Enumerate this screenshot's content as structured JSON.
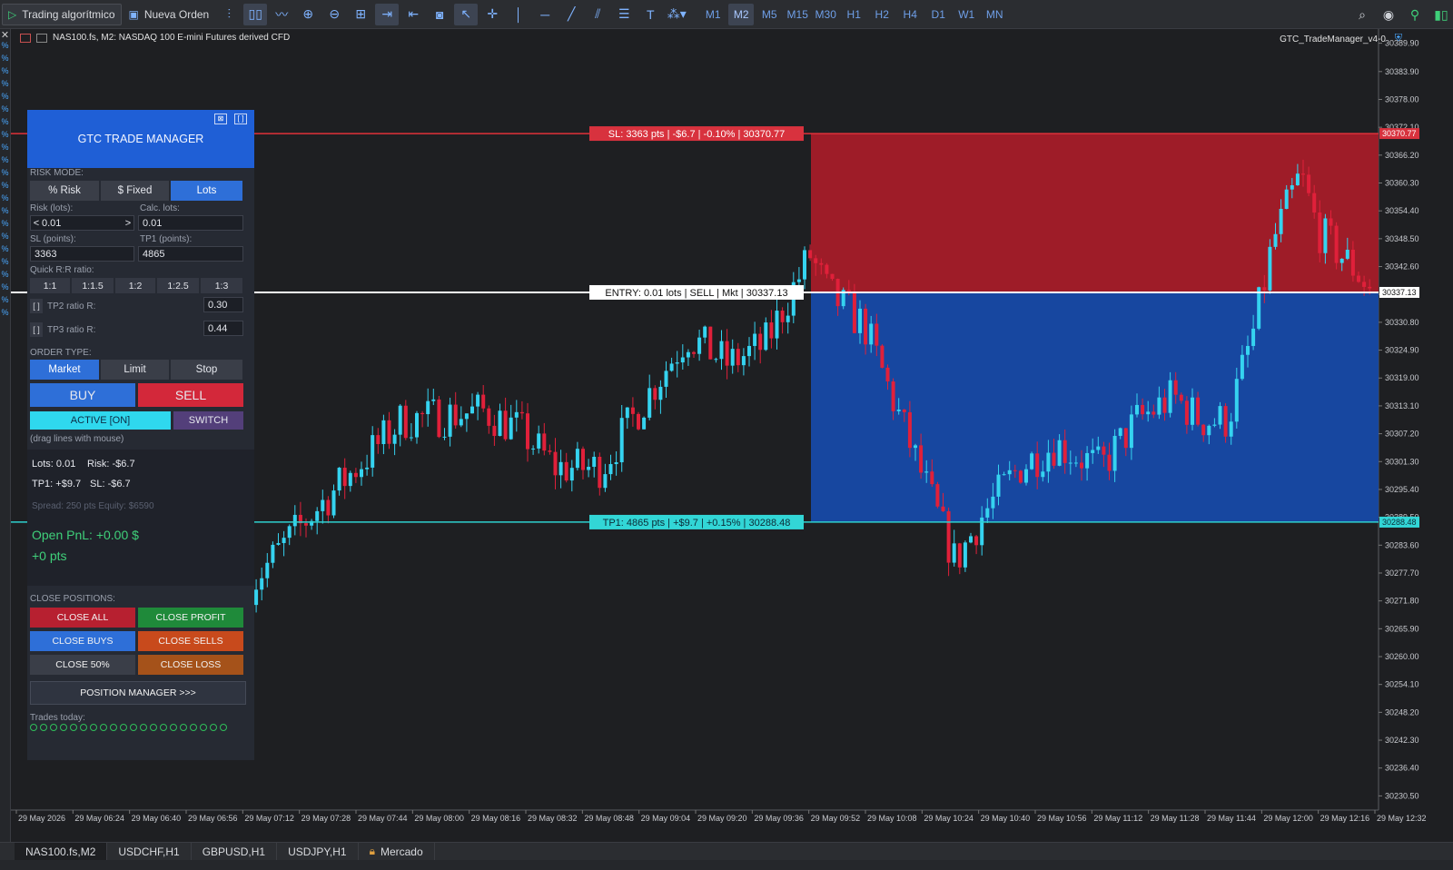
{
  "toolbar": {
    "algo_trading": "Trading algorítmico",
    "new_order": "Nueva Orden",
    "timeframes": [
      "M1",
      "M2",
      "M5",
      "M15",
      "M30",
      "H1",
      "H2",
      "H4",
      "D1",
      "W1",
      "MN"
    ],
    "active_timeframe": "M2"
  },
  "chart": {
    "symbol_title": "NAS100.fs, M2:  NASDAQ 100 E-mini Futures derived CFD",
    "ea_name": "GTC_TradeManager_v4-0",
    "price_levels": [
      "30389.90",
      "30383.90",
      "30378.00",
      "30372.10",
      "30366.20",
      "30360.30",
      "30354.40",
      "30348.50",
      "30342.60",
      "30336.70",
      "30330.80",
      "30324.90",
      "30319.00",
      "30313.10",
      "30307.20",
      "30301.30",
      "30295.40",
      "30289.50",
      "30283.60",
      "30277.70",
      "30271.80",
      "30265.90",
      "30260.00",
      "30254.10",
      "30248.20",
      "30242.30",
      "30236.40",
      "30230.50"
    ],
    "time_labels": [
      "29 May 2026",
      "29 May 06:24",
      "29 May 06:40",
      "29 May 06:56",
      "29 May 07:12",
      "29 May 07:28",
      "29 May 07:44",
      "29 May 08:00",
      "29 May 08:16",
      "29 May 08:32",
      "29 May 08:48",
      "29 May 09:04",
      "29 May 09:20",
      "29 May 09:36",
      "29 May 09:52",
      "29 May 10:08",
      "29 May 10:24",
      "29 May 10:40",
      "29 May 10:56",
      "29 May 11:12",
      "29 May 11:28",
      "29 May 11:44",
      "29 May 12:00",
      "29 May 12:16",
      "29 May 12:32"
    ],
    "sl_label": "SL: 3363 pts | -$6.7 | -0.10% | 30370.77",
    "entry_label": "ENTRY: 0.01 lots | SELL | Mkt | 30337.13",
    "tp_label": "TP1: 4865 pts | +$9.7 | +0.15% | 30288.48",
    "sl_price_tag": "30370.77",
    "entry_price_tag": "30337.13",
    "tp_price_tag": "30288.48",
    "colors": {
      "bull": "#35d3f0",
      "bear": "#e0203a",
      "sl_zone": "#9e1c28",
      "tp_zone": "#1747a0",
      "sl_line": "#e0303a",
      "tp_line": "#2fd0d0"
    }
  },
  "chart_data": {
    "type": "candlestick",
    "ylim": [
      30227.5,
      30392.9
    ],
    "sl": 30370.77,
    "entry": 30337.13,
    "tp": 30288.48
  },
  "panel": {
    "title": "GTC TRADE MANAGER",
    "risk_mode_label": "RISK MODE:",
    "risk_modes": [
      "% Risk",
      "$ Fixed",
      "Lots"
    ],
    "risk_label": "Risk (lots):",
    "risk_value": "0.01",
    "calc_lots_label": "Calc. lots:",
    "calc_lots_value": "0.01",
    "sl_points_label": "SL (points):",
    "sl_points_value": "3363",
    "tp1_points_label": "TP1 (points):",
    "tp1_points_value": "4865",
    "rr_label": "Quick R:R ratio:",
    "rr_ratios": [
      "1:1",
      "1:1.5",
      "1:2",
      "1:2.5",
      "1:3"
    ],
    "tp2_label": "TP2 ratio R:",
    "tp2_value": "0.30",
    "tp3_label": "TP3 ratio R:",
    "tp3_value": "0.44",
    "order_type_label": "ORDER TYPE:",
    "order_types": [
      "Market",
      "Limit",
      "Stop"
    ],
    "buy": "BUY",
    "sell": "SELL",
    "active": "ACTIVE [ON]",
    "switch": "SWITCH",
    "drag_hint": "(drag lines with mouse)",
    "lots_info": "Lots: 0.01",
    "risk_info": "Risk: -$6.7",
    "tp_info": "TP1: +$9.7",
    "sl_info": "SL: -$6.7",
    "spread_info": "Spread: 250 pts   Equity: $6590",
    "open_pnl": "Open PnL: +0.00 $",
    "open_pts": "+0 pts",
    "close_label": "CLOSE POSITIONS:",
    "close_all": "CLOSE ALL",
    "close_profit": "CLOSE PROFIT",
    "close_buys": "CLOSE BUYS",
    "close_sells": "CLOSE SELLS",
    "close_50": "CLOSE 50%",
    "close_loss": "CLOSE LOSS",
    "position_manager": "POSITION MANAGER  >>>",
    "trades_today": "Trades today:"
  },
  "bottom_tabs": [
    "NAS100.fs,M2",
    "USDCHF,H1",
    "GBPUSD,H1",
    "USDJPY,H1",
    "Mercado"
  ]
}
